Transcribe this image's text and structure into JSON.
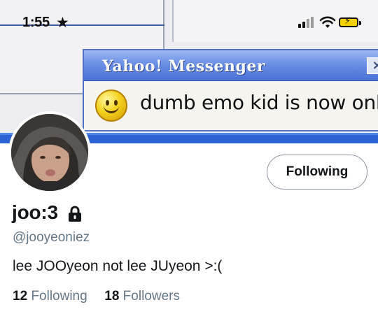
{
  "status_bar": {
    "time": "1:55",
    "star_glyph": "★",
    "icons": [
      "signal-icon",
      "wifi-icon",
      "battery-charging-icon"
    ],
    "battery_color": "#f5d000"
  },
  "header_image": {
    "popup_title": "Yahoo! Messenger",
    "popup_close": "×",
    "popup_message": "dumb emo kid is now online",
    "titlebar_color": "#4a72d8",
    "smiley_icon": "smiley-icon"
  },
  "profile": {
    "follow_button_label": "Following",
    "display_name": "joo:3",
    "protected_icon": "lock-icon",
    "handle": "@jooyeoniez",
    "bio": "lee JOOyeon not lee JUyeon >:(",
    "following_count": "12",
    "following_label": "Following",
    "followers_count": "18",
    "followers_label": "Followers"
  }
}
